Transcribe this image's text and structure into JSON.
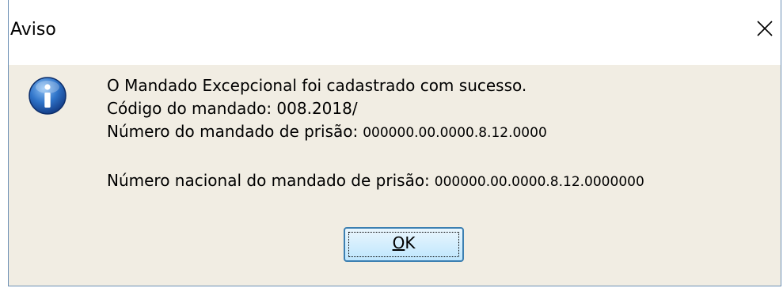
{
  "dialog": {
    "title": "Aviso",
    "icon": "info-icon",
    "close_icon": "close-icon",
    "lines": {
      "line1": "O Mandado Excepcional foi cadastrado com sucesso.",
      "line2": "Código do mandado: 008.2018/",
      "line3_label": "Número do mandado de prisão:",
      "line3_value": "000000.00.0000.8.12.0000",
      "line4_label": "Número nacional do mandado de prisão:",
      "line4_value": "000000.00.0000.8.12.0000000"
    },
    "ok_button": {
      "label_mnemonic": "O",
      "label_rest": "K"
    }
  }
}
